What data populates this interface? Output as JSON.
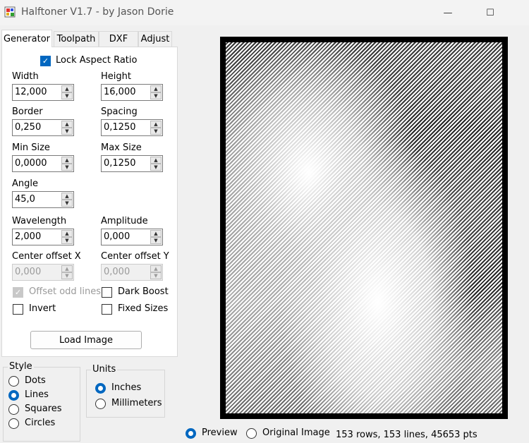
{
  "window": {
    "title": "Halftoner V1.7 - by Jason Dorie",
    "minimize": "—",
    "maximize": "☐"
  },
  "tabs": [
    "Generator",
    "Toolpath",
    "DXF",
    "Adjust"
  ],
  "generator": {
    "lock_aspect": "Lock Aspect Ratio",
    "width_label": "Width",
    "width_value": "12,000",
    "height_label": "Height",
    "height_value": "16,000",
    "border_label": "Border",
    "border_value": "0,250",
    "spacing_label": "Spacing",
    "spacing_value": "0,1250",
    "minsize_label": "Min Size",
    "minsize_value": "0,0000",
    "maxsize_label": "Max Size",
    "maxsize_value": "0,1250",
    "angle_label": "Angle",
    "angle_value": "45,0",
    "wavelength_label": "Wavelength",
    "wavelength_value": "2,000",
    "amplitude_label": "Amplitude",
    "amplitude_value": "0,000",
    "cox_label": "Center offset X",
    "cox_value": "0,000",
    "coy_label": "Center offset Y",
    "coy_value": "0,000",
    "offset_odd": "Offset odd lines",
    "dark_boost": "Dark Boost",
    "invert": "Invert",
    "fixed_sizes": "Fixed Sizes",
    "load_image": "Load Image"
  },
  "style_group": {
    "title": "Style",
    "options": [
      "Dots",
      "Lines",
      "Squares",
      "Circles"
    ],
    "selected": "Lines"
  },
  "units_group": {
    "title": "Units",
    "options": [
      "Inches",
      "Millimeters"
    ],
    "selected": "Inches"
  },
  "bottom": {
    "preview": "Preview",
    "original": "Original Image",
    "status": "153 rows, 153 lines, 45653 pts"
  }
}
